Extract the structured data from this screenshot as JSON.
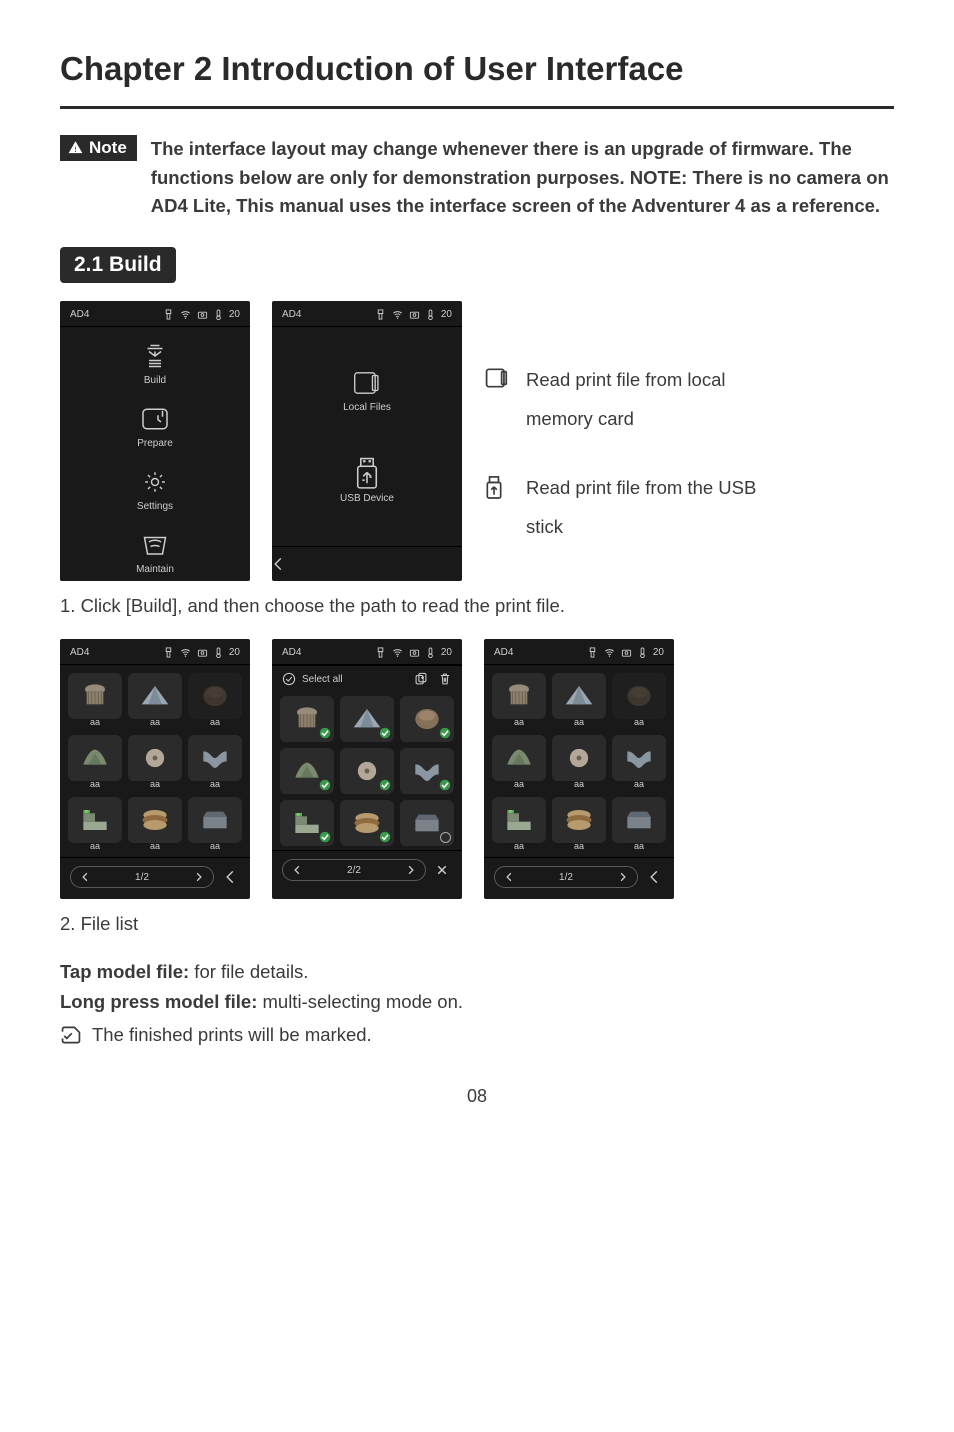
{
  "title": "Chapter 2 Introduction of User Interface",
  "note_badge": "Note",
  "note_text": "The interface layout may change whenever there is an upgrade of firmware. The functions below are only for demonstration purposes. NOTE: There is no camera on AD4 Lite, This manual uses the interface screen of the Adventurer 4 as a reference.",
  "section_2_1": "2.1 Build",
  "device_title": "AD4",
  "status_temp": "20",
  "menu": {
    "build": "Build",
    "prepare": "Prepare",
    "settings": "Settings",
    "maintain": "Maintain"
  },
  "file_source": {
    "local": "Local Files",
    "usb": "USB Device"
  },
  "legend": {
    "local": "Read print file from local memory card",
    "usb": "Read print file from the USB stick"
  },
  "step1": "1. Click [Build], and then choose the path to read the print file.",
  "select_all": "Select all",
  "file_label": "aa",
  "page_1_2": "1/2",
  "page_2_2": "2/2",
  "step2": "2. File list",
  "tap_label": "Tap model file:",
  "tap_text": "  for file details.",
  "long_label": "Long press model file:",
  "long_text": "  multi-selecting mode on.",
  "mark_text": "The finished prints will be marked.",
  "page_number": "08"
}
